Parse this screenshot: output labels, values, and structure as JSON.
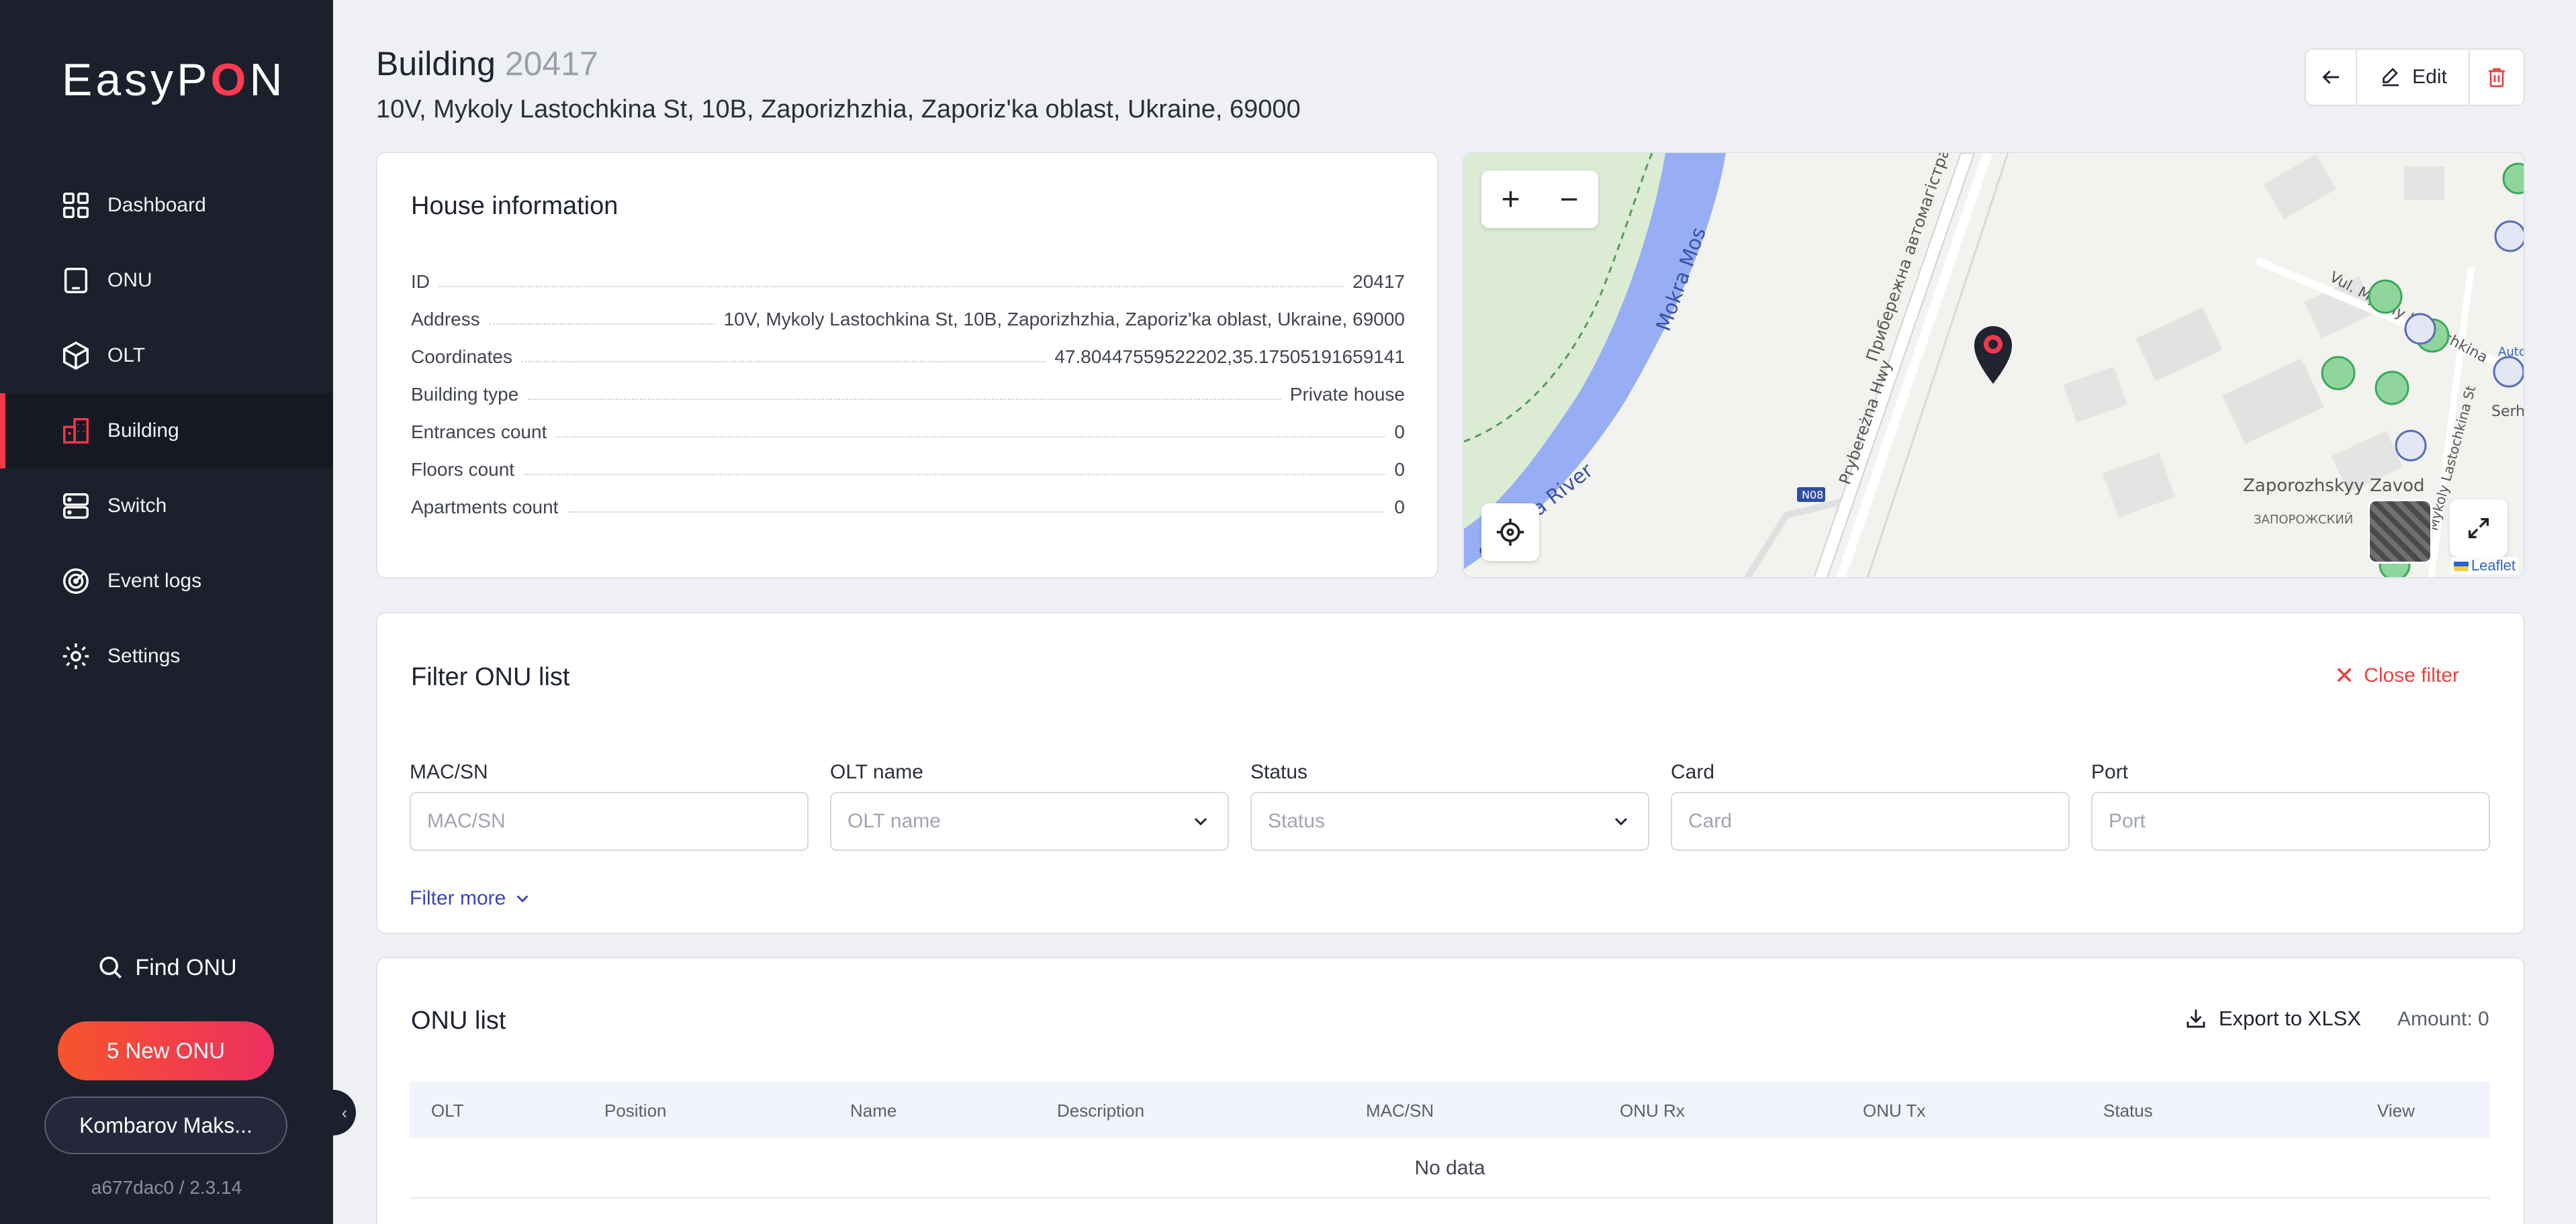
{
  "app": {
    "logo_left": "EasyP",
    "logo_o": "O",
    "logo_right": "N"
  },
  "sidebar": {
    "items": [
      {
        "label": "Dashboard",
        "icon": "grid-icon"
      },
      {
        "label": "ONU",
        "icon": "square-icon"
      },
      {
        "label": "OLT",
        "icon": "cube-icon"
      },
      {
        "label": "Building",
        "icon": "building-icon",
        "active": true
      },
      {
        "label": "Switch",
        "icon": "server-icon"
      },
      {
        "label": "Event logs",
        "icon": "radar-icon"
      },
      {
        "label": "Settings",
        "icon": "gear-icon"
      }
    ],
    "find_onu": "Find ONU",
    "new_onu": "5 New ONU",
    "user": "Kombarov Maks...",
    "version": "a677dac0 / 2.3.14"
  },
  "header": {
    "title": "Building",
    "number": "20417",
    "address": "10V, Mykoly Lastochkina St, 10B, Zaporizhzhia, Zaporiz'ka oblast, Ukraine, 69000",
    "edit_label": "Edit"
  },
  "house_info": {
    "title": "House information",
    "rows": [
      {
        "key": "ID",
        "value": "20417"
      },
      {
        "key": "Address",
        "value": "10V, Mykoly Lastochkina St, 10B, Zaporizhzhia, Zaporiz'ka oblast, Ukraine, 69000"
      },
      {
        "key": "Coordinates",
        "value": "47.80447559522202,35.17505191659141"
      },
      {
        "key": "Building type",
        "value": "Private house"
      },
      {
        "key": "Entrances count",
        "value": "0"
      },
      {
        "key": "Floors count",
        "value": "0"
      },
      {
        "key": "Apartments count",
        "value": "0"
      }
    ]
  },
  "map": {
    "labels": {
      "river1": "Mokra Mos",
      "river2": "oskovka River",
      "road1": "Прибережна автомагістраль",
      "road2": "Prybereżna Hwy",
      "road3": "Vul. Mykoly Lastochkina",
      "road4": "Mykoly Lastochkina St",
      "road5": "Serhii",
      "place1": "Zaporozhskyy Zavod",
      "place2": "ЗАПОРОЖСКИЙ",
      "road_badge": "N08",
      "auto": "Auto"
    },
    "attribution": "Leaflet"
  },
  "filter": {
    "title": "Filter ONU list",
    "close_label": "Close filter",
    "fields": [
      {
        "label": "MAC/SN",
        "placeholder": "MAC/SN"
      },
      {
        "label": "OLT name",
        "placeholder": "OLT name"
      },
      {
        "label": "Status",
        "placeholder": "Status"
      },
      {
        "label": "Card",
        "placeholder": "Card"
      },
      {
        "label": "Port",
        "placeholder": "Port"
      }
    ],
    "more_label": "Filter more"
  },
  "onu_list": {
    "title": "ONU list",
    "export_label": "Export to XLSX",
    "amount": "Amount: 0",
    "columns": [
      "OLT",
      "Position",
      "Name",
      "Description",
      "MAC/SN",
      "ONU Rx",
      "ONU Tx",
      "Status",
      "View"
    ],
    "empty": "No data"
  },
  "colors": {
    "accent": "#f4384b",
    "sidebar_bg": "#1c1f2c",
    "link": "#3a46b8",
    "danger": "#e8433e"
  }
}
